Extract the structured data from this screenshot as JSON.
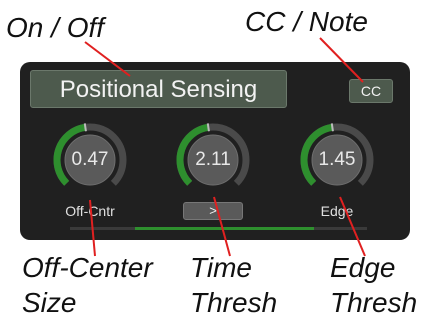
{
  "callouts": {
    "on_off": "On / Off",
    "cc_note": "CC / Note",
    "off_center_size": [
      "Off-Center",
      "Size"
    ],
    "time_thresh": [
      "Time",
      "Thresh"
    ],
    "edge_thresh": [
      "Edge",
      "Thresh"
    ]
  },
  "panel": {
    "toggle_label": "Positional Sensing",
    "cc_label": "CC",
    "arrow_button_label": ">",
    "knobs": [
      {
        "value": "0.47",
        "label": "Off-Cntr",
        "level": 0.47
      },
      {
        "value": "2.11",
        "label": "",
        "level": 0.47
      },
      {
        "value": "1.45",
        "label": "Edge",
        "level": 0.47
      }
    ],
    "range_bar": {
      "start": 0.22,
      "end": 0.82
    }
  },
  "colors": {
    "accent_green": "#2e8f2e",
    "button_bg": "#4d5a4d",
    "panel_bg": "#202020"
  }
}
